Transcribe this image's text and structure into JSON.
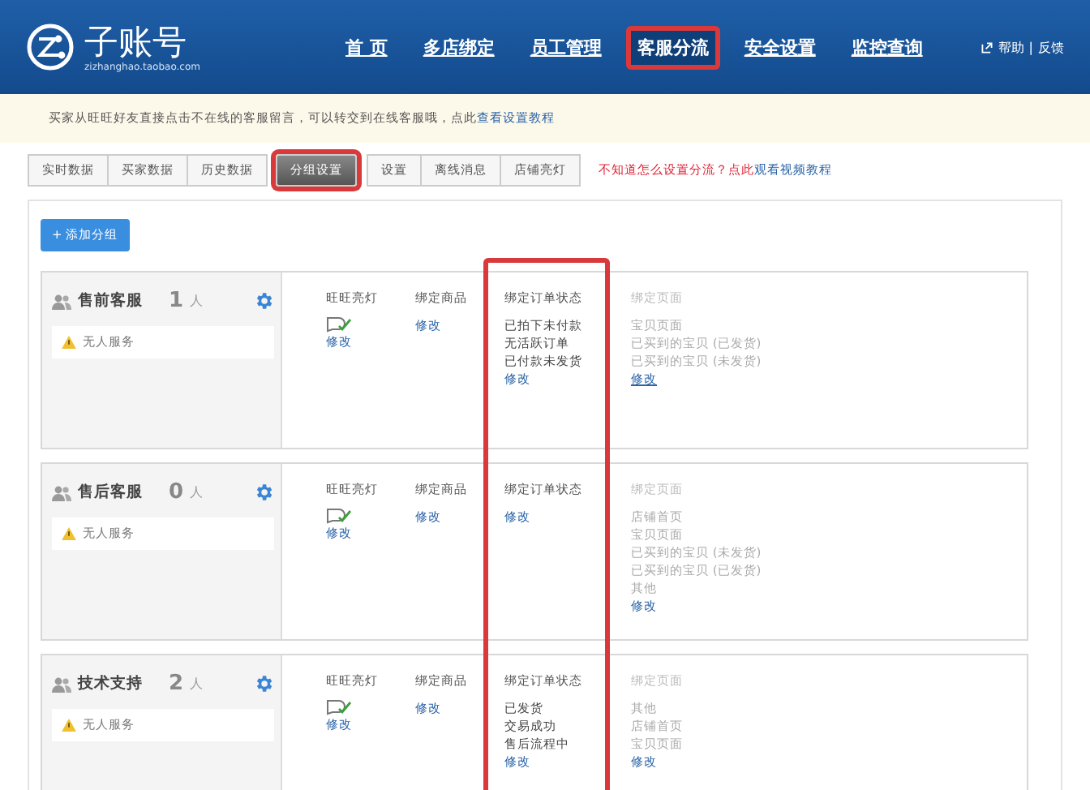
{
  "header": {
    "logo_title": "子账号",
    "logo_subtitle": "zizhanghao.taobao.com",
    "nav": [
      {
        "label": "首 页",
        "selected": false,
        "highlighted": false
      },
      {
        "label": "多店绑定",
        "selected": false,
        "highlighted": false
      },
      {
        "label": "员工管理",
        "selected": false,
        "highlighted": false
      },
      {
        "label": "客服分流",
        "selected": true,
        "highlighted": true
      },
      {
        "label": "安全设置",
        "selected": false,
        "highlighted": false
      },
      {
        "label": "监控查询",
        "selected": false,
        "highlighted": false
      }
    ],
    "help": "帮助",
    "separator": "|",
    "feedback": "反馈"
  },
  "notice": {
    "text": "买家从旺旺好友直接点击不在线的客服留言，可以转交到在线客服哦，点此",
    "link": "查看设置教程"
  },
  "tabs": [
    {
      "label": "实时数据",
      "selected": false,
      "highlighted": false
    },
    {
      "label": "买家数据",
      "selected": false,
      "highlighted": false
    },
    {
      "label": "历史数据",
      "selected": false,
      "highlighted": false
    },
    {
      "label": "分组设置",
      "selected": true,
      "highlighted": true
    },
    {
      "label": "设置",
      "selected": false,
      "highlighted": false
    },
    {
      "label": "离线消息",
      "selected": false,
      "highlighted": false
    },
    {
      "label": "店铺亮灯",
      "selected": false,
      "highlighted": false
    }
  ],
  "tab_hint": {
    "text": "不知道怎么设置分流？点此",
    "link": "观看视频教程"
  },
  "add_group_button": "+ 添加分组",
  "highlight_order_column": true,
  "groups": [
    {
      "name": "售前客服",
      "count": "1",
      "unit": "人",
      "warning": "无人服务",
      "wangwang": {
        "title": "旺旺亮灯",
        "edit": "修改"
      },
      "goods": {
        "title": "绑定商品",
        "edit": "修改"
      },
      "order": {
        "title": "绑定订单状态",
        "items": [
          "已拍下未付款",
          "无活跃订单",
          "已付款未发货"
        ],
        "edit": "修改"
      },
      "page": {
        "title": "绑定页面",
        "items": [
          "宝贝页面",
          "已买到的宝贝 (已发货)",
          "已买到的宝贝 (未发货)"
        ],
        "edit": "修改"
      }
    },
    {
      "name": "售后客服",
      "count": "0",
      "unit": "人",
      "warning": "无人服务",
      "wangwang": {
        "title": "旺旺亮灯",
        "edit": "修改"
      },
      "goods": {
        "title": "绑定商品",
        "edit": "修改"
      },
      "order": {
        "title": "绑定订单状态",
        "edit": "修改"
      },
      "page": {
        "title": "绑定页面",
        "items": [
          "店铺首页",
          "宝贝页面",
          "已买到的宝贝 (未发货)",
          "已买到的宝贝 (已发货)",
          "其他"
        ],
        "edit": "修改"
      }
    },
    {
      "name": "技术支持",
      "count": "2",
      "unit": "人",
      "warning": "无人服务",
      "wangwang": {
        "title": "旺旺亮灯",
        "edit": "修改"
      },
      "goods": {
        "title": "绑定商品",
        "edit": "修改"
      },
      "order": {
        "title": "绑定订单状态",
        "items": [
          "已发货",
          "交易成功",
          "售后流程中"
        ],
        "edit": "修改"
      },
      "page": {
        "title": "绑定页面",
        "items": [
          "其他",
          "店铺首页",
          "宝贝页面"
        ],
        "edit": "修改"
      }
    }
  ]
}
